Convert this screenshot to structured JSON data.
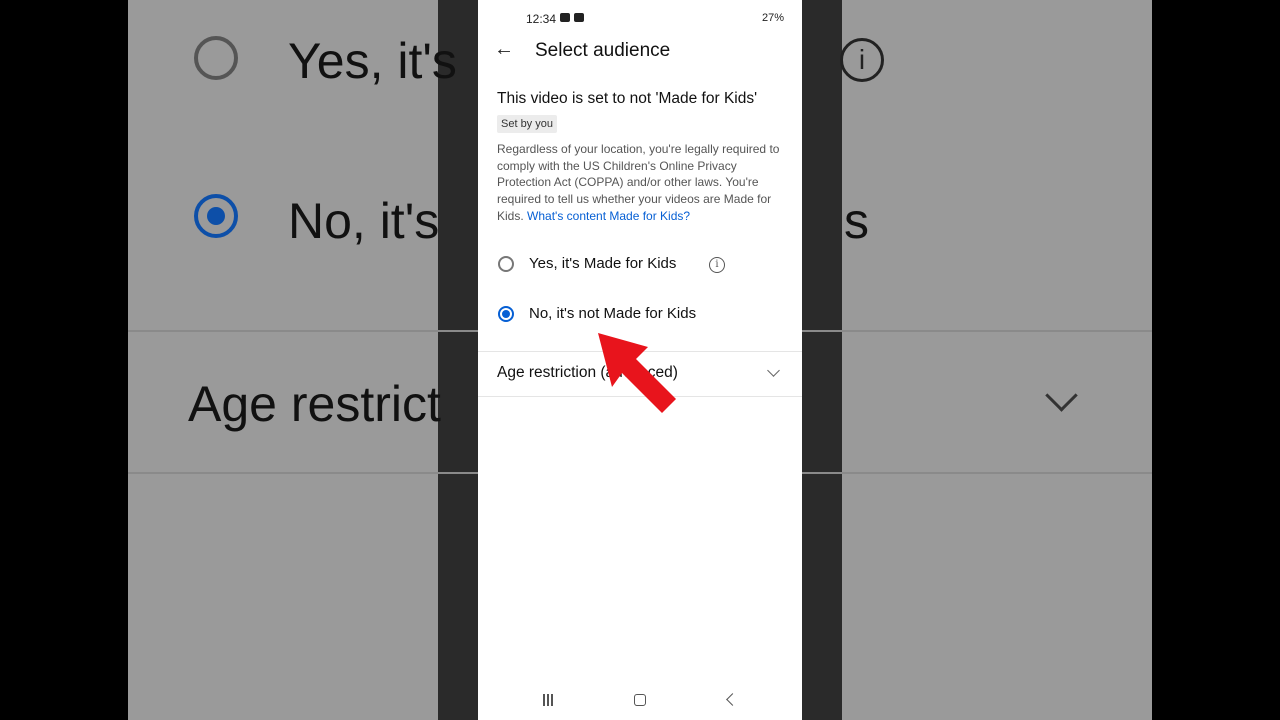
{
  "status_bar": {
    "time": "12:34",
    "battery": "27%"
  },
  "app_bar": {
    "back_icon": "arrow-left-icon",
    "title": "Select audience"
  },
  "heading": "This video is set to not 'Made for Kids'",
  "chip": "Set by you",
  "description": {
    "text": "Regardless of your location, you're legally required to comply with the US Children's Online Privacy Protection Act (COPPA) and/or other laws. You're required to tell us whether your videos are Made for Kids.",
    "link": "What's content Made for Kids?"
  },
  "options": [
    {
      "label": "Yes, it's Made for Kids",
      "selected": false,
      "has_info_icon": true
    },
    {
      "label": "No, it's not Made for Kids",
      "selected": true
    }
  ],
  "accordion": {
    "label": "Age restriction (advanced)"
  },
  "colors": {
    "accent": "#065fd4",
    "annotation_arrow": "#e8141c"
  }
}
